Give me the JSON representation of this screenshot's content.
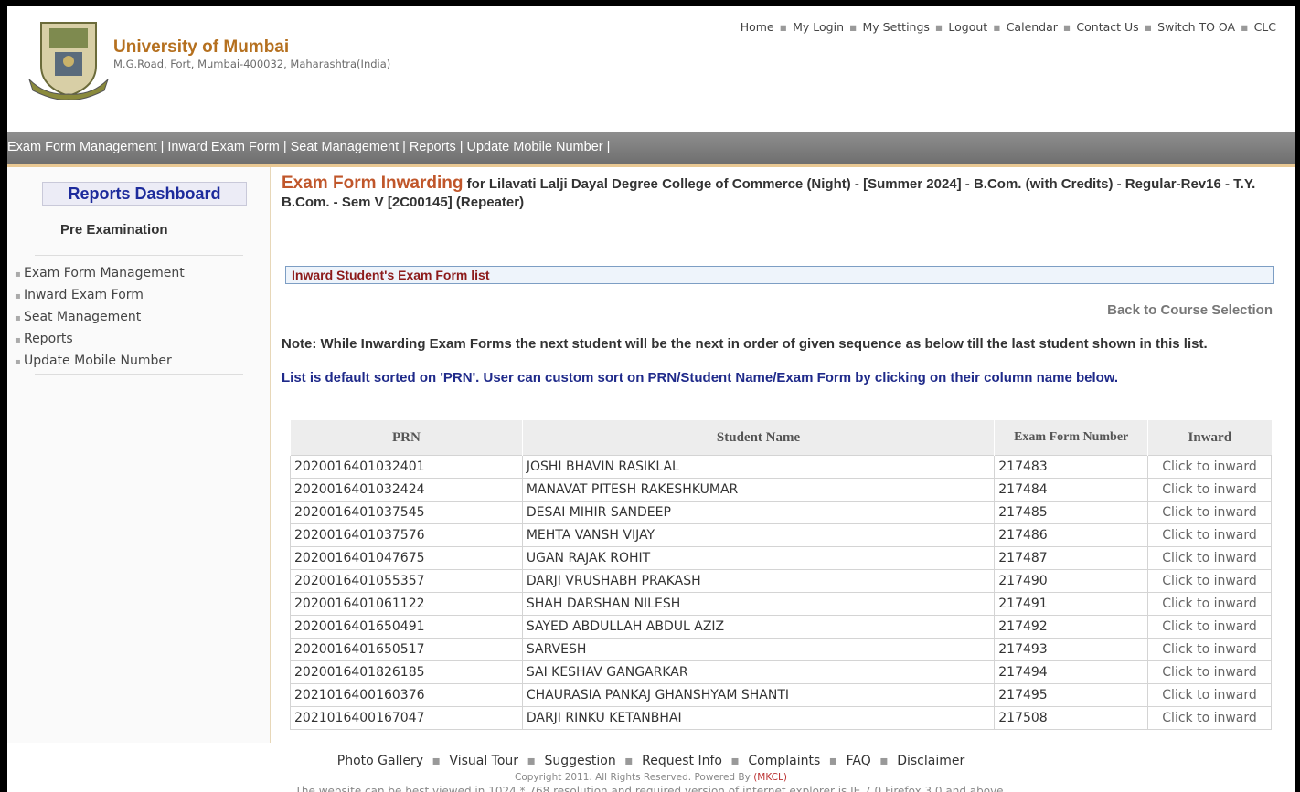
{
  "header": {
    "university_name": "University of Mumbai",
    "address": "M.G.Road, Fort, Mumbai-400032, Maharashtra(India)",
    "top_links": [
      "Home",
      "My Login",
      "My Settings",
      "Logout",
      "Calendar",
      "Contact Us",
      "Switch TO OA",
      "CLC"
    ]
  },
  "navbar": {
    "items": [
      "Exam Form Management",
      "Inward Exam Form",
      "Seat Management",
      "Reports",
      "Update Mobile Number"
    ]
  },
  "sidebar": {
    "title": "Reports Dashboard",
    "section": "Pre Examination",
    "items": [
      "Exam Form Management",
      "Inward Exam Form",
      "Seat Management",
      "Reports",
      "Update Mobile Number"
    ]
  },
  "main": {
    "heading_main": "Exam Form Inwarding",
    "heading_rest": "for Lilavati Lalji Dayal Degree College of Commerce (Night) - [Summer 2024] - B.Com. (with Credits) - Regular-Rev16 - T.Y. B.Com. - Sem V [2C00145] (Repeater)",
    "list_title": "Inward Student's Exam Form list",
    "back_link": "Back to Course Selection",
    "note1": "Note: While Inwarding Exam Forms the next student will be the next in order of given sequence as below till the last student shown in this list.",
    "note2": "List is default sorted on 'PRN'. User can custom sort on PRN/Student Name/Exam Form by clicking on their column name below.",
    "table": {
      "headers": [
        "PRN",
        "Student Name",
        "Exam Form Number",
        "Inward"
      ],
      "rows": [
        [
          "2020016401032401",
          "JOSHI BHAVIN RASIKLAL",
          "217483",
          "Click to inward"
        ],
        [
          "2020016401032424",
          "MANAVAT PITESH RAKESHKUMAR",
          "217484",
          "Click to inward"
        ],
        [
          "2020016401037545",
          "DESAI MIHIR SANDEEP",
          "217485",
          "Click to inward"
        ],
        [
          "2020016401037576",
          "MEHTA VANSH VIJAY",
          "217486",
          "Click to inward"
        ],
        [
          "2020016401047675",
          "UGAN RAJAK ROHIT",
          "217487",
          "Click to inward"
        ],
        [
          "2020016401055357",
          "DARJI VRUSHABH PRAKASH",
          "217490",
          "Click to inward"
        ],
        [
          "2020016401061122",
          "SHAH DARSHAN NILESH",
          "217491",
          "Click to inward"
        ],
        [
          "2020016401650491",
          "SAYED ABDULLAH ABDUL AZIZ",
          "217492",
          "Click to inward"
        ],
        [
          "2020016401650517",
          "SARVESH",
          "217493",
          "Click to inward"
        ],
        [
          "2020016401826185",
          "SAI KESHAV GANGARKAR",
          "217494",
          "Click to inward"
        ],
        [
          "2021016400160376",
          "CHAURASIA PANKAJ GHANSHYAM SHANTI",
          "217495",
          "Click to inward"
        ],
        [
          "2021016400167047",
          "DARJI RINKU KETANBHAI",
          "217508",
          "Click to inward"
        ]
      ]
    }
  },
  "footer": {
    "links": [
      "Photo Gallery",
      "Visual Tour",
      "Suggestion",
      "Request Info",
      "Complaints",
      "FAQ",
      "Disclaimer"
    ],
    "copyright": "Copyright 2011. All Rights Reserved. Powered By",
    "powered_by": "(MKCL)",
    "best_view": "The website can be best viewed in 1024 * 768 resolution and required version of internet explorer is IE 7.0 Firefox 3.0 and above."
  },
  "colors": {
    "accent_orange": "#b5701f",
    "heading_orange": "#c0562a",
    "dashboard_blue": "#1d2b9c",
    "list_title_red": "#8c1a1a",
    "navbar_gray": "#7a7a7a"
  },
  "icons": {
    "logo": "university-crest-logo"
  }
}
